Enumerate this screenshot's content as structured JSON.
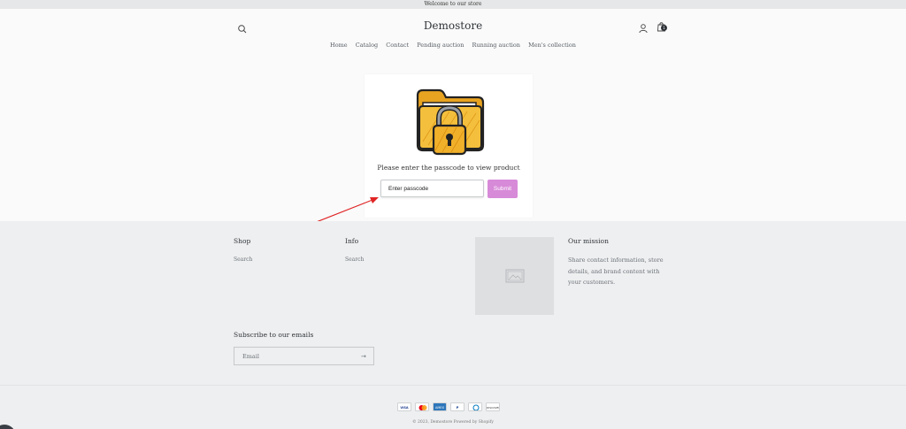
{
  "announcement": "Welcome to our store",
  "header": {
    "store_name": "Demostore",
    "cart_count": "1",
    "nav": [
      "Home",
      "Catalog",
      "Contact",
      "Pending auction",
      "Running auction",
      "Men's collection"
    ]
  },
  "passcode_card": {
    "prompt": "Please enter the passcode to view product",
    "input_placeholder": "Enter passcode",
    "submit_label": "Submit",
    "colors": {
      "submit_bg": "#d78ad8",
      "folder": "#f0b429",
      "annotation_arrow": "#e02424"
    }
  },
  "footer": {
    "shop": {
      "title": "Shop",
      "links": [
        "Search"
      ]
    },
    "info": {
      "title": "Info",
      "links": [
        "Search"
      ]
    },
    "mission": {
      "title": "Our mission",
      "text": "Share contact information, store details, and brand content with your customers."
    },
    "subscribe": {
      "title": "Subscribe to our emails",
      "email_label": "Email"
    },
    "payments": [
      "VISA",
      "MC",
      "AMEX",
      "P",
      "DC",
      "DISCOVER"
    ],
    "copyright": "© 2023, Demostore Powered by Shopify"
  },
  "icons": [
    "search-icon",
    "account-icon",
    "cart-icon",
    "lock-folder-icon",
    "image-placeholder-icon",
    "arrow-right-icon"
  ]
}
